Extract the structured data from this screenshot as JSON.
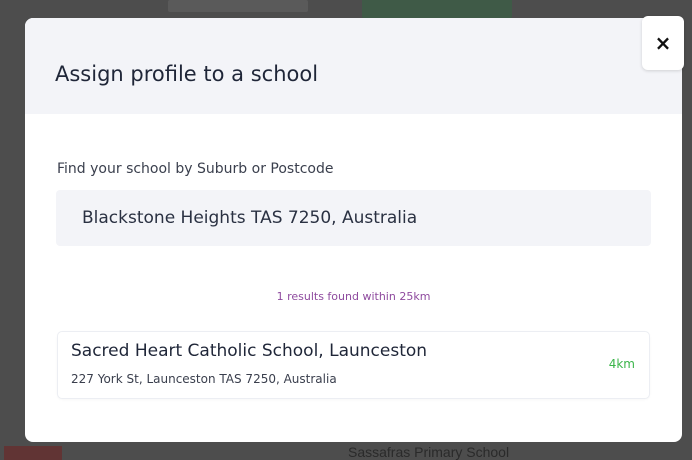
{
  "background": {
    "partial_school": "Sassafras Primary School"
  },
  "modal": {
    "title": "Assign profile to a school",
    "close_label": "×",
    "search": {
      "label": "Find your school by Suburb or Postcode",
      "value": "Blackstone Heights TAS 7250, Australia",
      "placeholder": ""
    },
    "results_count": "1 results found within 25km",
    "results": [
      {
        "name": "Sacred Heart Catholic School, Launceston",
        "address": "227 York St, Launceston TAS 7250, Australia",
        "distance": "4km"
      }
    ]
  },
  "colors": {
    "backdrop": "#4d4d4d",
    "header": "#f3f4f8",
    "results_accent": "#8e4a9e",
    "distance_accent": "#3bb54a"
  }
}
